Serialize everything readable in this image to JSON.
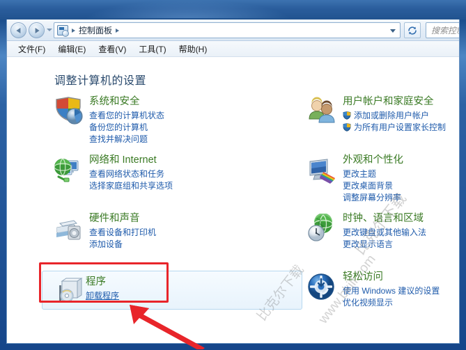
{
  "window": {
    "titlebar": {
      "title": ""
    },
    "address": {
      "breadcrumb_root": "控制面板",
      "crumb_separator": "▶",
      "refresh_icon": "refresh-icon",
      "cp_icon": "control-panel-icon",
      "dropdown_icon": "chevron-down-icon"
    },
    "search": {
      "placeholder": "搜索控制面板",
      "value": "搜索控"
    },
    "menubar": {
      "items": [
        {
          "label": "文件(F)",
          "name": "menu-file"
        },
        {
          "label": "编辑(E)",
          "name": "menu-edit"
        },
        {
          "label": "查看(V)",
          "name": "menu-view"
        },
        {
          "label": "工具(T)",
          "name": "menu-tools"
        },
        {
          "label": "帮助(H)",
          "name": "menu-help"
        }
      ]
    }
  },
  "content": {
    "heading": "调整计算机的设置",
    "left_categories": [
      {
        "title": "系统和安全",
        "icon": "shield-security-icon",
        "links": [
          {
            "label": "查看您的计算机状态",
            "shield": false
          },
          {
            "label": "备份您的计算机",
            "shield": false
          },
          {
            "label": "查找并解决问题",
            "shield": false
          }
        ]
      },
      {
        "title": "网络和 Internet",
        "icon": "network-globe-icon",
        "links": [
          {
            "label": "查看网络状态和任务",
            "shield": false
          },
          {
            "label": "选择家庭组和共享选项",
            "shield": false
          }
        ]
      },
      {
        "title": "硬件和声音",
        "icon": "printer-speaker-icon",
        "links": [
          {
            "label": "查看设备和打印机",
            "shield": false
          },
          {
            "label": "添加设备",
            "shield": false
          }
        ]
      },
      {
        "title": "程序",
        "icon": "programs-disc-icon",
        "hovered": true,
        "links": [
          {
            "label": "卸载程序",
            "shield": false
          }
        ]
      }
    ],
    "right_categories": [
      {
        "title": "用户帐户和家庭安全",
        "icon": "users-icon",
        "links": [
          {
            "label": "添加或删除用户帐户",
            "shield": true
          },
          {
            "label": "为所有用户设置家长控制",
            "shield": true
          }
        ]
      },
      {
        "title": "外观和个性化",
        "icon": "appearance-monitor-icon",
        "links": [
          {
            "label": "更改主题",
            "shield": false
          },
          {
            "label": "更改桌面背景",
            "shield": false
          },
          {
            "label": "调整屏幕分辨率",
            "shield": false
          }
        ]
      },
      {
        "title": "时钟、语言和区域",
        "icon": "clock-globe-icon",
        "links": [
          {
            "label": "更改键盘或其他输入法",
            "shield": false
          },
          {
            "label": "更改显示语言",
            "shield": false
          }
        ]
      },
      {
        "title": "轻松访问",
        "icon": "ease-of-access-icon",
        "links": [
          {
            "label": "使用 Windows 建议的设置",
            "shield": false
          },
          {
            "label": "优化视频显示",
            "shield": false
          }
        ]
      }
    ]
  },
  "annotations": {
    "highlight_box_color": "#e8252a",
    "arrow_color": "#e8252a",
    "arrow_target": "程序"
  },
  "watermark": {
    "line1": "www.bkill.com",
    "line2": "比克尔下载",
    "line3": "比克尔下载"
  },
  "colors": {
    "category_title": "#3a7a24",
    "link": "#1f5bab",
    "heading": "#2a4a6d",
    "frame": "#1c4f8e",
    "hover_tile": "#e8f3fc"
  }
}
